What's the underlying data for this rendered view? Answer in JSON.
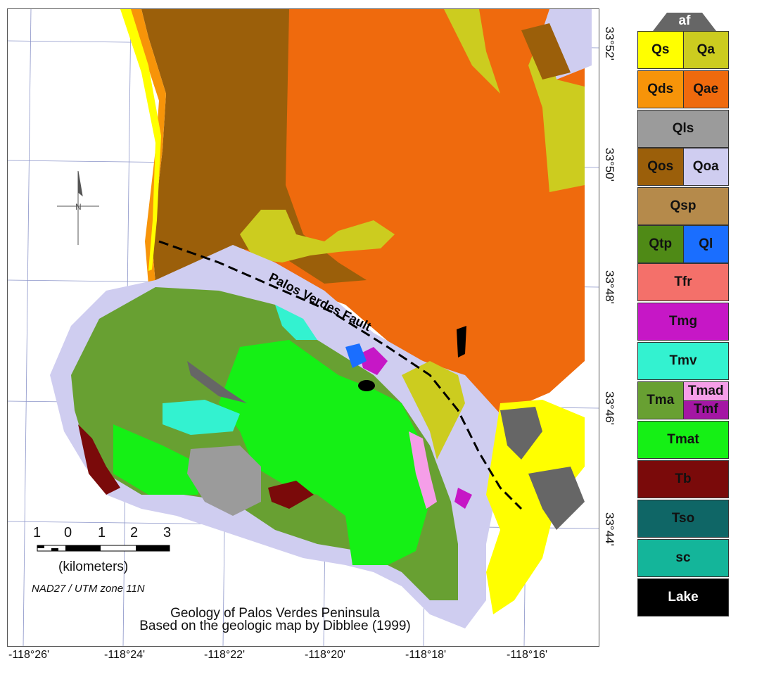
{
  "map": {
    "title_line1": "Geology of Palos Verdes Peninsula",
    "title_line2": "Based on the geologic map by Dibblee (1999)",
    "fault_label": "Palos Verdes Fault",
    "projection": "NAD27 / UTM zone 11N",
    "scale_unit": "(kilometers)",
    "scale_ticks": [
      "1",
      "0",
      "1",
      "2",
      "3"
    ],
    "lat_labels": [
      "33°52'",
      "33°50'",
      "33°48'",
      "33°46'",
      "33°44'"
    ],
    "lon_labels": [
      "-118°26'",
      "-118°24'",
      "-118°22'",
      "-118°20'",
      "-118°18'",
      "-118°16'"
    ]
  },
  "legend": {
    "header": "af",
    "rows": [
      [
        {
          "label": "Qs",
          "color": "#ffff00"
        },
        {
          "label": "Qa",
          "color": "#cccc1f"
        }
      ],
      [
        {
          "label": "Qds",
          "color": "#f79409"
        },
        {
          "label": "Qae",
          "color": "#ef6a0d"
        }
      ],
      [
        {
          "label": "Qls",
          "color": "#9b9b9b"
        }
      ],
      [
        {
          "label": "Qos",
          "color": "#9b5f0a"
        },
        {
          "label": "Qoa",
          "color": "#cfcdf0"
        }
      ],
      [
        {
          "label": "Qsp",
          "color": "#b58a4b"
        }
      ],
      [
        {
          "label": "Qtp",
          "color": "#4f8a16"
        },
        {
          "label": "Ql",
          "color": "#1a6eff"
        }
      ],
      [
        {
          "label": "Tfr",
          "color": "#f4706a"
        }
      ],
      [
        {
          "label": "Tmg",
          "color": "#c617c6"
        }
      ],
      [
        {
          "label": "Tmv",
          "color": "#33f2d0"
        }
      ],
      [
        {
          "label": "Tma",
          "color": "#68a032"
        },
        {
          "label": "Tmad",
          "color": "#f59ee8",
          "sub": "Tmf",
          "sub_color": "#a416a4"
        }
      ],
      [
        {
          "label": "Tmat",
          "color": "#15f015"
        }
      ],
      [
        {
          "label": "Tb",
          "color": "#7a0a0a"
        }
      ],
      [
        {
          "label": "Tso",
          "color": "#0f6666"
        }
      ],
      [
        {
          "label": "sc",
          "color": "#14b59a"
        }
      ],
      [
        {
          "label": "Lake",
          "color": "#000000",
          "text_color": "#ffffff"
        }
      ]
    ]
  }
}
